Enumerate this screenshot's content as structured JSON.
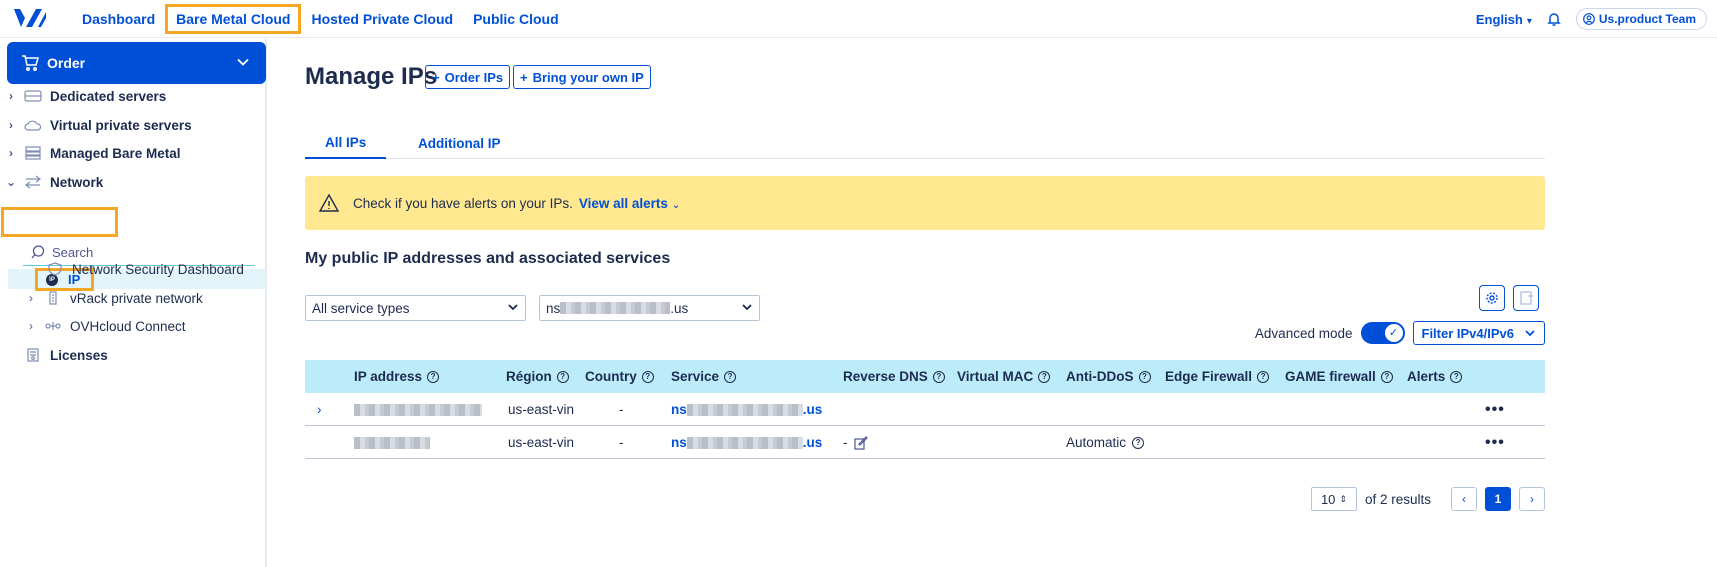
{
  "topnav": {
    "items": [
      "Dashboard",
      "Bare Metal Cloud",
      "Hosted Private Cloud",
      "Public Cloud"
    ],
    "highlighted": "Bare Metal Cloud",
    "language": "English",
    "user": "Us.product Team"
  },
  "sidebar": {
    "order_label": "Order",
    "items": [
      {
        "label": "Dedicated servers",
        "icon": "server-icon"
      },
      {
        "label": "Virtual private servers",
        "icon": "cloud-icon"
      },
      {
        "label": "Managed Bare Metal",
        "icon": "stack-icon"
      },
      {
        "label": "Network",
        "icon": "network-icon"
      }
    ],
    "search_placeholder": "Search",
    "network_children": [
      {
        "label": "IP",
        "icon": "ip-icon"
      },
      {
        "label": "Network Security Dashboard",
        "icon": "shield-icon"
      },
      {
        "label": "vRack private network",
        "icon": "vrack-icon"
      },
      {
        "label": "OVHcloud Connect",
        "icon": "connect-icon"
      }
    ],
    "licenses_label": "Licenses"
  },
  "main": {
    "title": "Manage IPs",
    "order_ips": "Order IPs",
    "bring_ip": "Bring your own IP",
    "tabs": [
      "All IPs",
      "Additional IP"
    ],
    "active_tab": "All IPs",
    "alert_text": "Check if you have alerts on your IPs.",
    "alert_link": "View all alerts",
    "section_title": "My public IP addresses and associated services",
    "service_type": "All service types",
    "service_prefix": "ns",
    "service_suffix": ".us",
    "advanced_mode": "Advanced mode",
    "advanced_on": true,
    "filter_label": "Filter IPv4/IPv6"
  },
  "table": {
    "headers": [
      "IP address",
      "Région",
      "Country",
      "Service",
      "Reverse DNS",
      "Virtual MAC",
      "Anti-DDoS",
      "Edge Firewall",
      "GAME firewall",
      "Alerts"
    ],
    "rows": [
      {
        "region": "us-east-vin",
        "country": "-",
        "service_prefix": "ns",
        "service_suffix": ".us",
        "reverse_dns": "",
        "anti_ddos": ""
      },
      {
        "region": "us-east-vin",
        "country": "-",
        "service_prefix": "ns",
        "service_suffix": ".us",
        "reverse_dns": "-",
        "anti_ddos": "Automatic"
      }
    ]
  },
  "pagination": {
    "page_size": "10",
    "results": "of 2 results",
    "current_page": "1"
  },
  "colors": {
    "primary": "#0050d7",
    "highlight": "#f5a623",
    "alert_bg": "#ffe88f",
    "table_header": "#bcecfa"
  }
}
